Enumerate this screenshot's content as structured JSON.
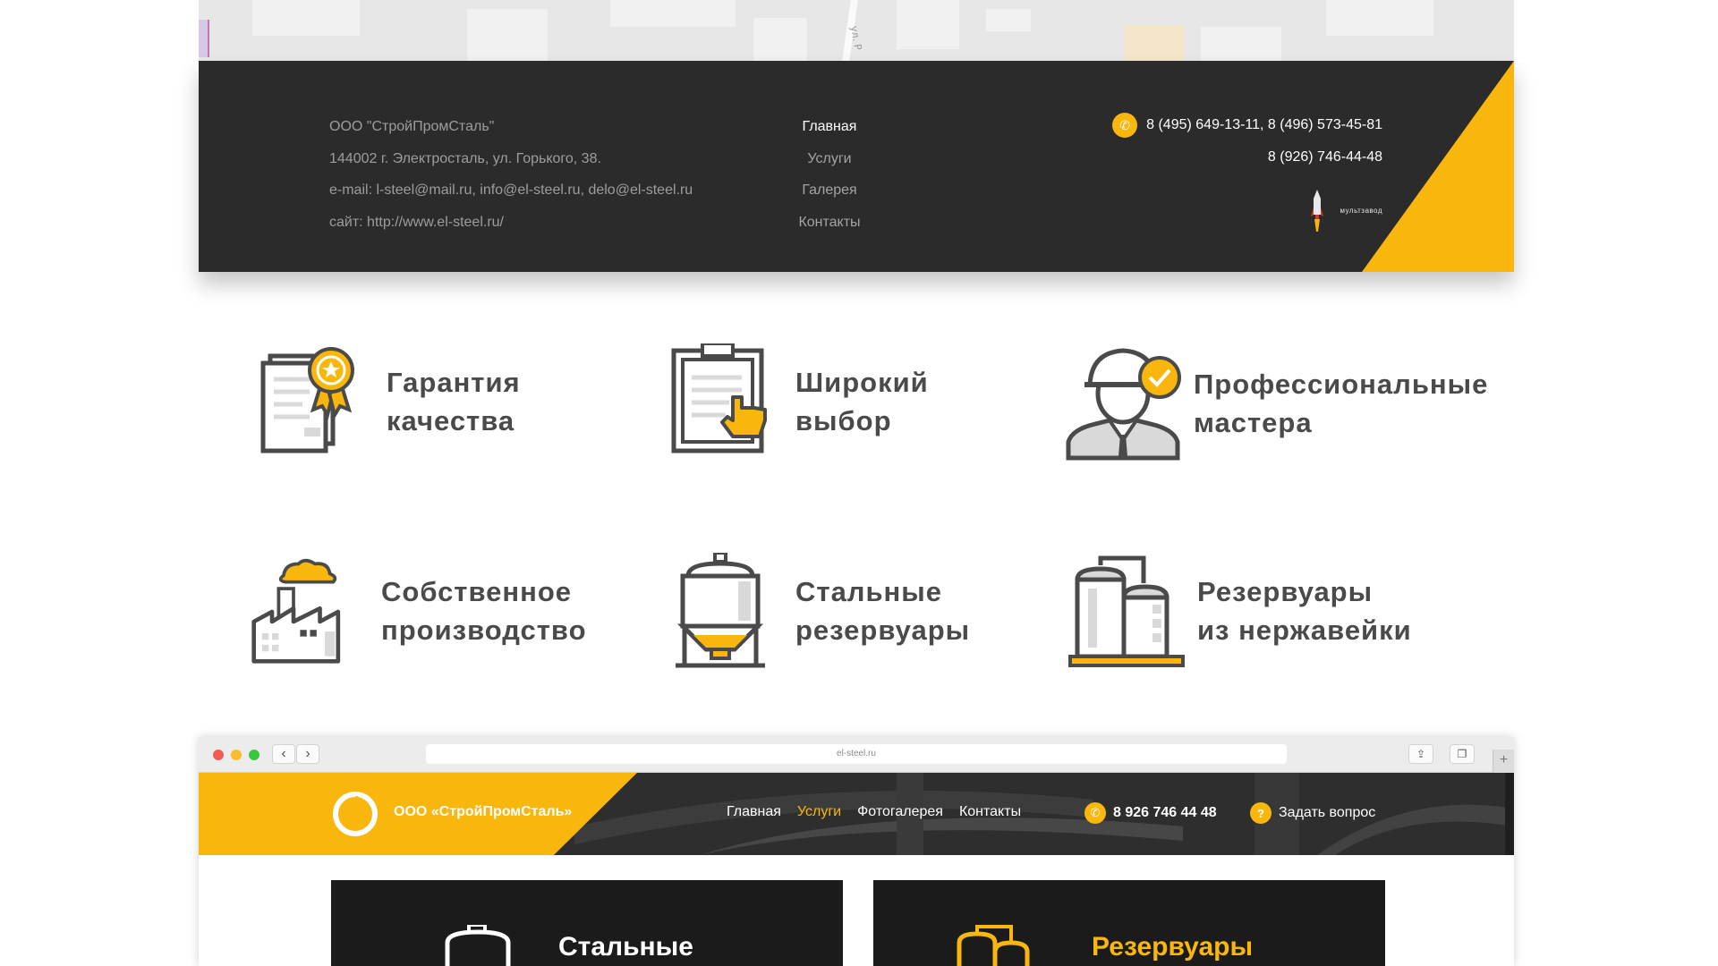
{
  "map": {
    "road_label": "ул. Р"
  },
  "footer": {
    "company": "ООО \"СтройПромСталь\"",
    "address": "144002 г. Электросталь, ул. Горького, 38.",
    "email": "e-mail: l-steel@mail.ru, info@el-steel.ru, delo@el-steel.ru",
    "site": "сайт: http://www.el-steel.ru/",
    "nav": [
      "Главная",
      "Услуги",
      "Галерея",
      "Контакты"
    ],
    "phone_main": "8 (495) 649-13-11, 8 (496) 573-45-81",
    "phone_mobile": "8 (926) 746-44-48",
    "developer_logo": "мультзавод"
  },
  "features": [
    {
      "line1": "Гарантия",
      "line2": "качества",
      "icon": "certificate-icon"
    },
    {
      "line1": "Широкий",
      "line2": "выбор",
      "icon": "clipboard-hand-icon"
    },
    {
      "line1": "Профессиональные",
      "line2": "мастера",
      "icon": "worker-icon"
    },
    {
      "line1": "Собственное",
      "line2": "производство",
      "icon": "factory-icon"
    },
    {
      "line1": "Стальные",
      "line2": "резервуары",
      "icon": "steel-tank-icon"
    },
    {
      "line1": "Резервуары",
      "line2": "из нержавейки",
      "icon": "stainless-tanks-icon"
    }
  ],
  "browser": {
    "url": "el-steel.ru",
    "site_name": "ООО «СтройПромСталь»",
    "nav": [
      "Главная",
      "Услуги",
      "Фотогалерея",
      "Контакты"
    ],
    "active_nav": "Услуги",
    "phone": "8 926 746 44 48",
    "ask": "Задать вопрос",
    "cards": [
      {
        "title": "Стальные"
      },
      {
        "title": "Резервуары"
      }
    ]
  },
  "colors": {
    "accent": "#f9b70e",
    "dark": "#2b2b2c",
    "text": "#4a4a4a"
  }
}
